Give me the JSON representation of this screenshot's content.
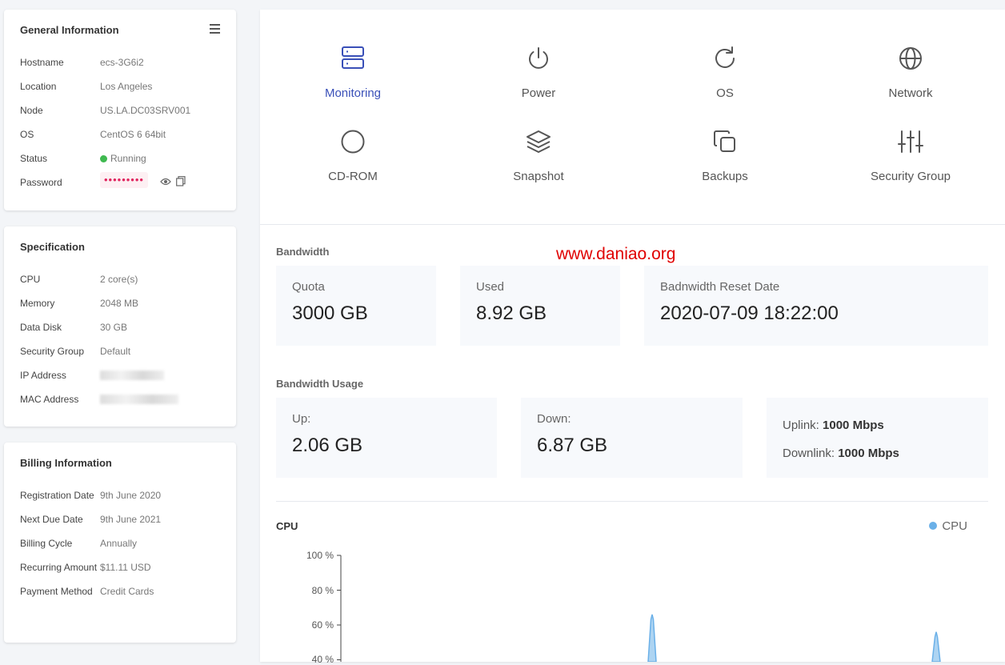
{
  "general": {
    "title": "General Information",
    "rows": [
      {
        "label": "Hostname",
        "value": "ecs-3G6i2"
      },
      {
        "label": "Location",
        "value": "Los Angeles"
      },
      {
        "label": "Node",
        "value": "US.LA.DC03SRV001"
      },
      {
        "label": "OS",
        "value": "CentOS 6 64bit"
      },
      {
        "label": "Status",
        "value": "Running"
      },
      {
        "label": "Password",
        "value": "•••••••••"
      }
    ]
  },
  "spec": {
    "title": "Specification",
    "rows": [
      {
        "label": "CPU",
        "value": "2 core(s)"
      },
      {
        "label": "Memory",
        "value": "2048 MB"
      },
      {
        "label": "Data Disk",
        "value": "30 GB"
      },
      {
        "label": "Security Group",
        "value": "Default"
      },
      {
        "label": "IP Address",
        "value": ""
      },
      {
        "label": "MAC Address",
        "value": ""
      }
    ]
  },
  "billing": {
    "title": "Billing Information",
    "rows": [
      {
        "label": "Registration Date",
        "value": "9th June 2020"
      },
      {
        "label": "Next Due Date",
        "value": "9th June 2021"
      },
      {
        "label": "Billing Cycle",
        "value": "Annually"
      },
      {
        "label": "Recurring Amount",
        "value": "$11.11 USD"
      },
      {
        "label": "Payment Method",
        "value": "Credit Cards"
      }
    ]
  },
  "tiles": [
    {
      "label": "Monitoring",
      "icon": "server-icon",
      "active": true
    },
    {
      "label": "Power",
      "icon": "power-icon"
    },
    {
      "label": "OS",
      "icon": "refresh-icon"
    },
    {
      "label": "Network",
      "icon": "globe-icon"
    },
    {
      "label": "CD-ROM",
      "icon": "circle-icon"
    },
    {
      "label": "Snapshot",
      "icon": "layers-icon"
    },
    {
      "label": "Backups",
      "icon": "copy-icon"
    },
    {
      "label": "Security Group",
      "icon": "sliders-icon"
    }
  ],
  "watermark": "www.daniao.org",
  "bandwidth": {
    "title": "Bandwidth",
    "quota_label": "Quota",
    "quota": "3000 GB",
    "used_label": "Used",
    "used": "8.92 GB",
    "reset_label": "Badnwidth Reset Date",
    "reset": "2020-07-09 18:22:00"
  },
  "usage": {
    "title": "Bandwidth Usage",
    "up_label": "Up:",
    "up": "2.06 GB",
    "down_label": "Down:",
    "down": "6.87 GB",
    "uplink_label": "Uplink:",
    "uplink": "1000 Mbps",
    "downlink_label": "Downlink:",
    "downlink": "1000 Mbps"
  },
  "chart_data": {
    "type": "area",
    "title": "CPU",
    "series": [
      {
        "name": "CPU",
        "color": "#6ab0e8"
      }
    ],
    "yticks": [
      "100 %",
      "80 %",
      "60 %",
      "40 %"
    ],
    "ylim": [
      0,
      100
    ],
    "spikes": [
      66,
      56
    ],
    "legend": "top-right"
  },
  "colors": {
    "accent": "#3a50b8",
    "running": "#3fb950",
    "password": "#e0245e",
    "cpu": "#6ab0e8"
  }
}
